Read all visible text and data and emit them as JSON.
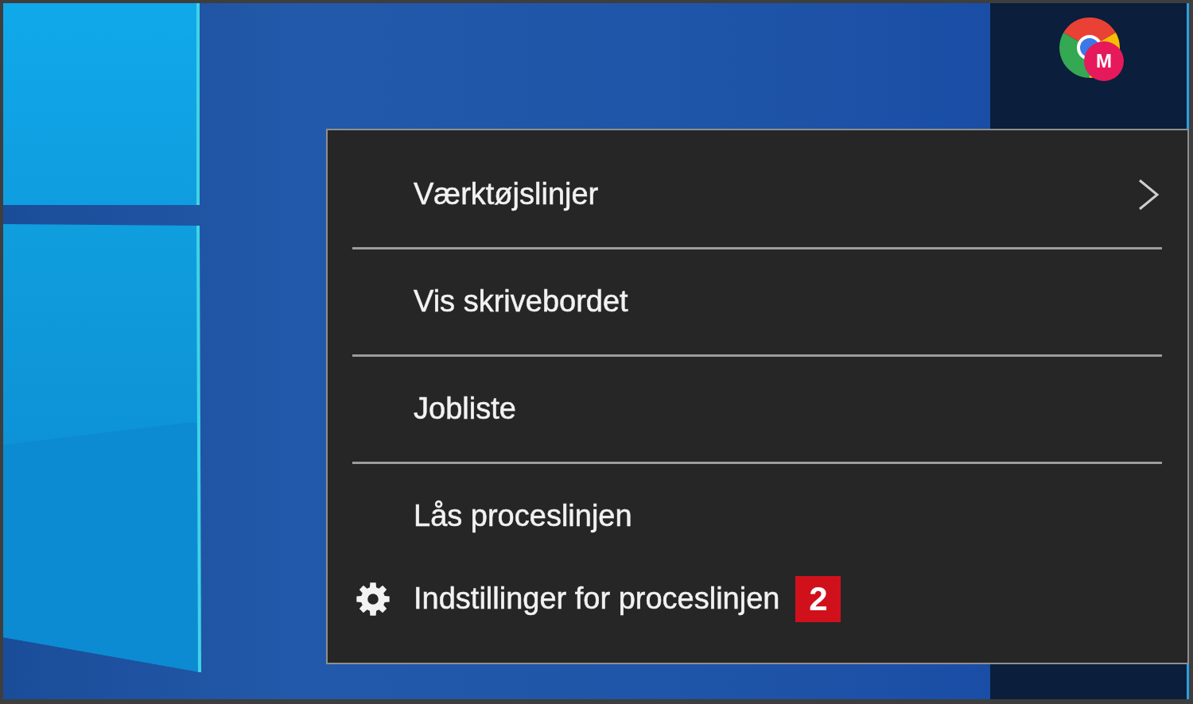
{
  "taskbar": {
    "pinned_app": {
      "profile_initial": "M"
    }
  },
  "context_menu": {
    "items": [
      {
        "label": "Værktøjslinjer",
        "kind": "submenu",
        "divider_after": true
      },
      {
        "label": "Vis skrivebordet",
        "kind": "plain",
        "divider_after": true
      },
      {
        "label": "Jobliste",
        "kind": "plain",
        "divider_after": true
      },
      {
        "label": "Lås proceslinjen",
        "kind": "plain",
        "divider_after": false
      },
      {
        "label": "Indstillinger for proceslinjen",
        "kind": "settings",
        "divider_after": false,
        "callout": "2"
      }
    ]
  }
}
